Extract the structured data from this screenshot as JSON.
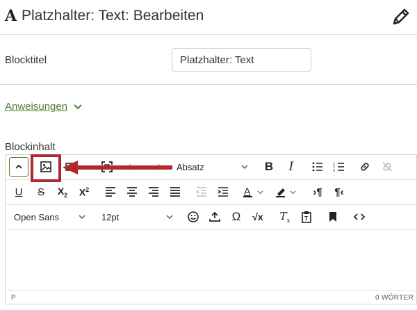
{
  "header": {
    "type_icon": "A",
    "title": "Platzhalter: Text: Bearbeiten",
    "edit_icon": "pencil-icon"
  },
  "block_title": {
    "label": "Blocktitel",
    "value": "Platzhalter: Text"
  },
  "instructions": {
    "label": "Anweisungen"
  },
  "block_content": {
    "label": "Blockinhalt"
  },
  "toolbar": {
    "paragraph_format": "Absatz",
    "font_family": "Open Sans",
    "font_size": "12pt"
  },
  "statusbar": {
    "path": "P",
    "word_count": "0 WÖRTER"
  },
  "colors": {
    "accent_green": "#4b7f2a",
    "annotation_red": "#b0272c"
  }
}
